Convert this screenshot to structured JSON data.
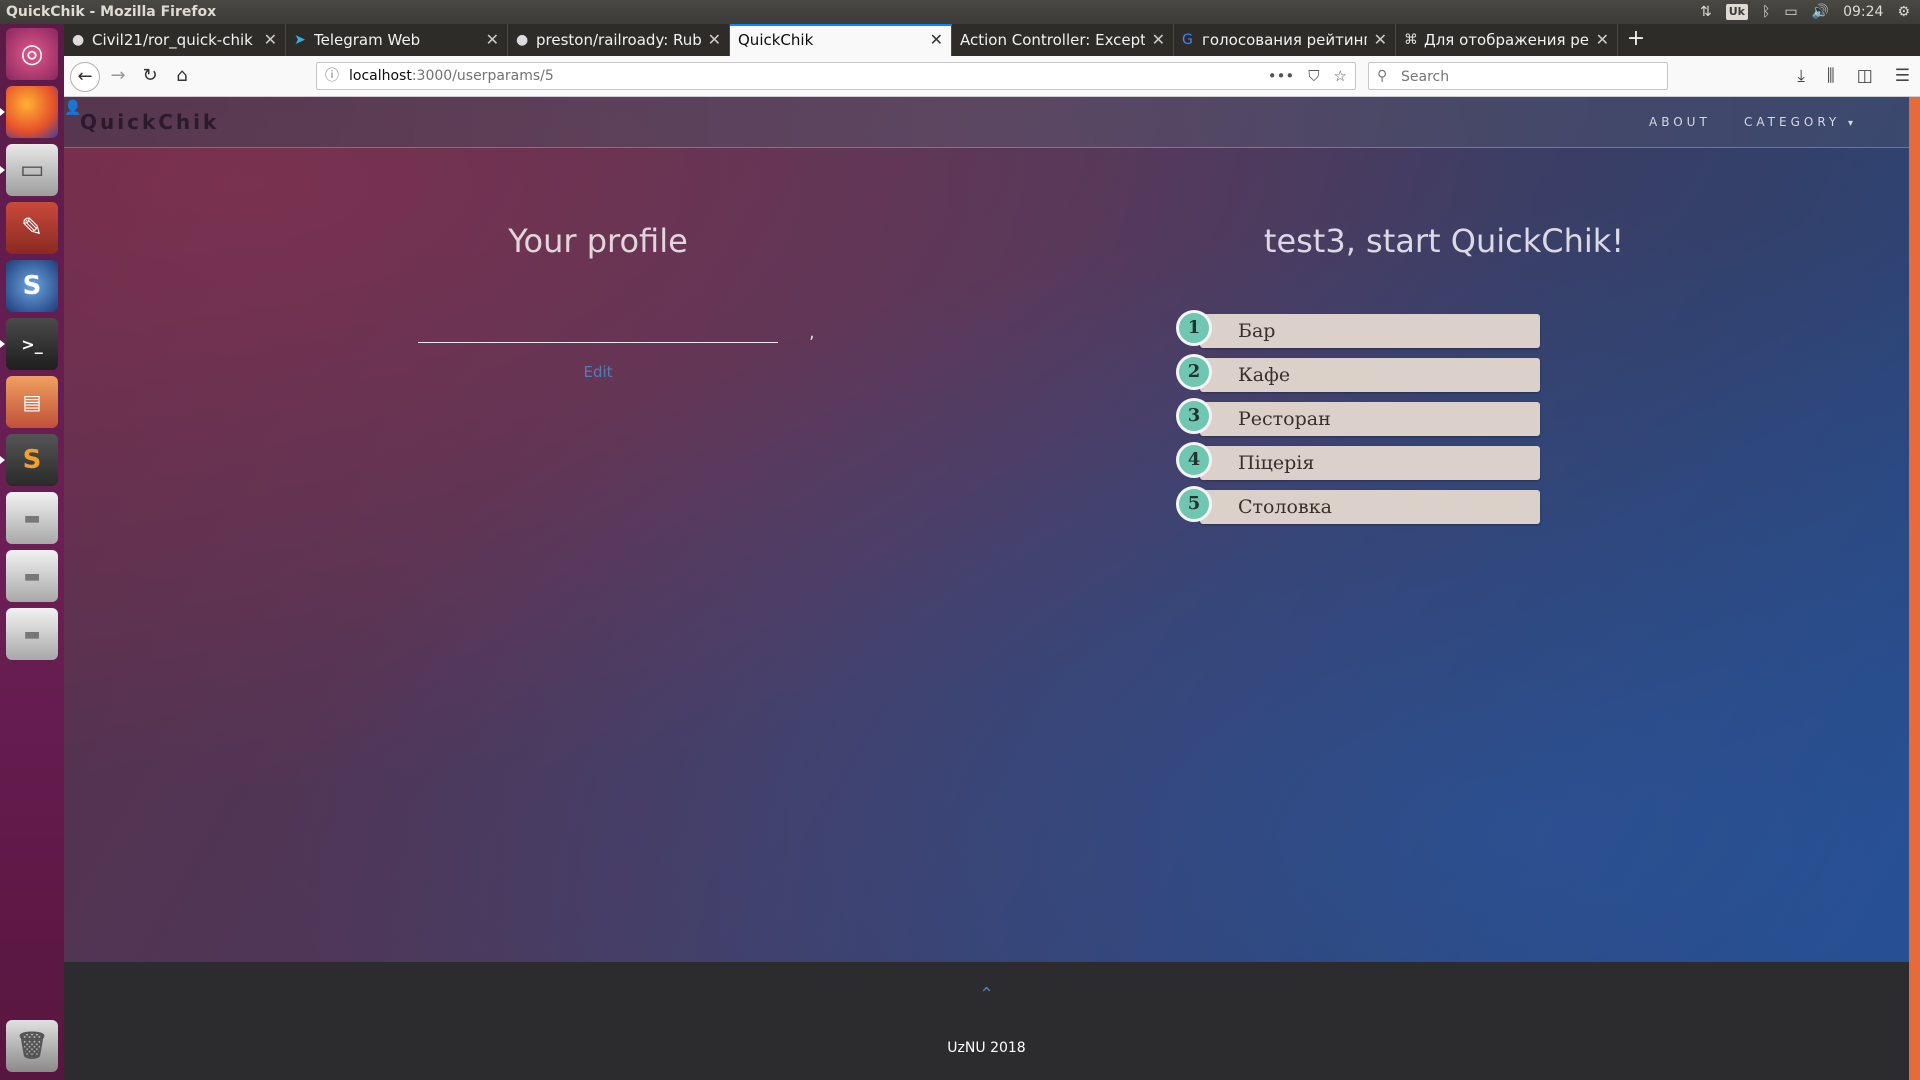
{
  "os": {
    "window_title": "QuickChik - Mozilla Firefox",
    "keyboard_layout": "Uk",
    "clock": "09:24"
  },
  "launcher": {
    "items": [
      {
        "name": "ubuntu-dash-icon"
      },
      {
        "name": "firefox-icon"
      },
      {
        "name": "files-icon"
      },
      {
        "name": "system-settings-icon"
      },
      {
        "name": "app-swirl-icon"
      },
      {
        "name": "terminal-icon"
      },
      {
        "name": "impress-icon"
      },
      {
        "name": "sublime-text-icon"
      },
      {
        "name": "drive-icon"
      },
      {
        "name": "drive-icon"
      },
      {
        "name": "drive-icon"
      },
      {
        "name": "trash-icon"
      }
    ]
  },
  "browser": {
    "tabs": [
      {
        "label": "Civil21/ror_quick-chik",
        "icon": "github-icon"
      },
      {
        "label": "Telegram Web",
        "icon": "telegram-icon"
      },
      {
        "label": "preston/railroady: Ruby",
        "icon": "github-icon"
      },
      {
        "label": "QuickChik",
        "icon": "",
        "active": true
      },
      {
        "label": "Action Controller: Exceptio",
        "icon": ""
      },
      {
        "label": "голосования рейтинг с",
        "icon": "google-icon"
      },
      {
        "label": "Для отображения рейт",
        "icon": "command-icon"
      }
    ],
    "url_host": "localhost",
    "url_path": ":3000/userparams/5",
    "search_placeholder": "Search"
  },
  "site": {
    "brand": "QuickChik",
    "nav": {
      "about": "ABOUT",
      "category": "CATEGORY"
    },
    "profile_title": "Your profile",
    "profile_separator": ",",
    "edit_label": "Edit",
    "welcome": "test3, start QuickChik!",
    "categories": [
      {
        "num": "1",
        "label": "Бар"
      },
      {
        "num": "2",
        "label": "Кафе"
      },
      {
        "num": "3",
        "label": "Ресторан"
      },
      {
        "num": "4",
        "label": "Піцерія"
      },
      {
        "num": "5",
        "label": "Столовка"
      }
    ],
    "footer_text": "UzNU 2018"
  },
  "colors": {
    "accent_tab": "#0a84ff",
    "category_badge": "#6fc7b2",
    "category_bar": "#dcd0cb",
    "link": "#4d7fb5",
    "launcher": "#6c1f56",
    "footer": "#2c2c2e"
  }
}
